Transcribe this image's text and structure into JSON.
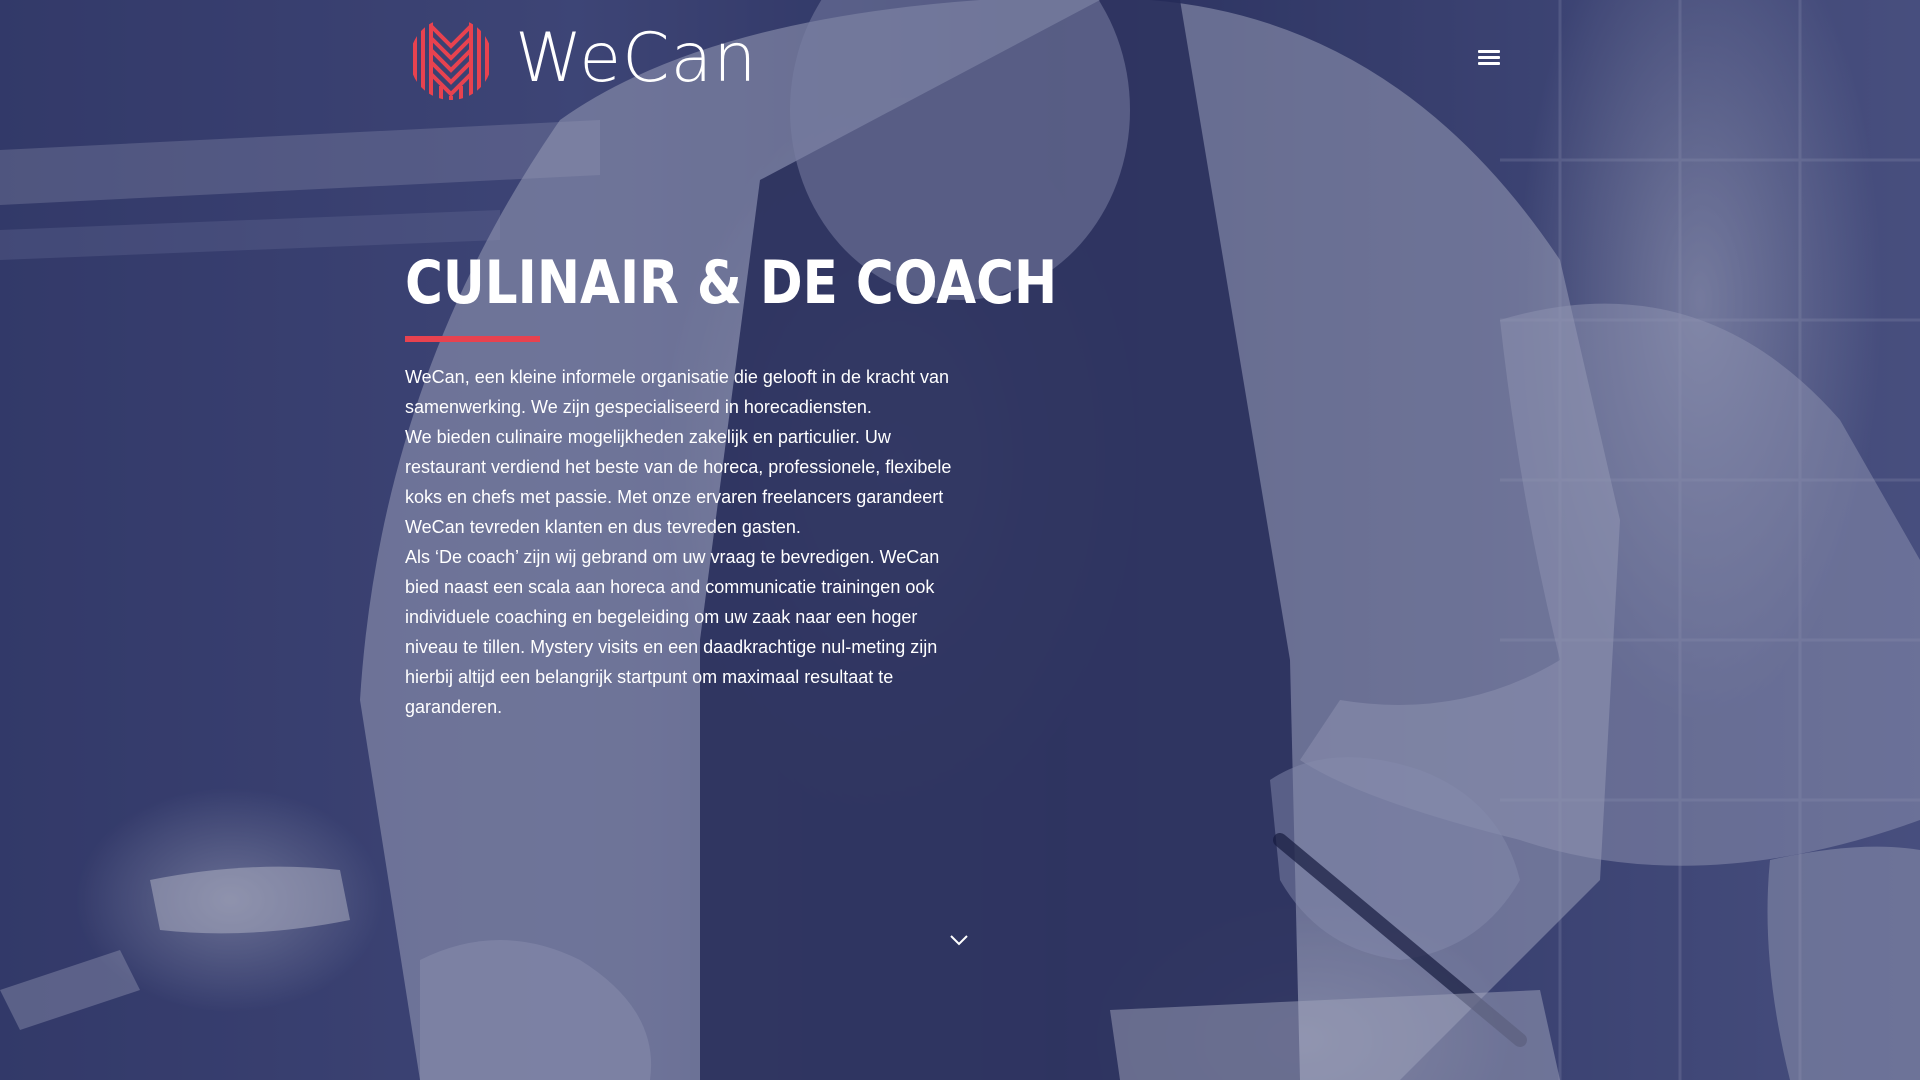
{
  "brand": {
    "name": "WeCan",
    "accent_color": "#e8424f",
    "logo_icon": "wecan-logo-icon"
  },
  "header": {
    "menu_icon": "hamburger-menu-icon"
  },
  "hero": {
    "title": "CULINAIR & DE COACH",
    "paragraphs": [
      "WeCan, een kleine informele organisatie die gelooft in de kracht van samenwerking. We zijn gespecialiseerd in horecadiensten.",
      "We bieden culinaire mogelijkheden zakelijk en particulier. Uw restaurant verdiend het beste van de horeca, professionele, flexibele koks en chefs met passie. Met onze ervaren freelancers garandeert WeCan tevreden klanten en dus tevreden gasten.",
      "Als ‘De coach’ zijn wij gebrand om uw vraag te bevredigen. WeCan bied naast een scala aan horeca and communicatie trainingen ook individuele coaching en begeleiding om uw zaak naar een hoger niveau te tillen. Mystery visits en een daadkrachtige nul-meting zijn hierbij altijd een belangrijk startpunt om maximaal resultaat te garanderen."
    ],
    "scroll_icon": "chevron-down-icon",
    "background_image": "chef-in-kitchen-photo",
    "overlay_color": "#2e3561"
  }
}
